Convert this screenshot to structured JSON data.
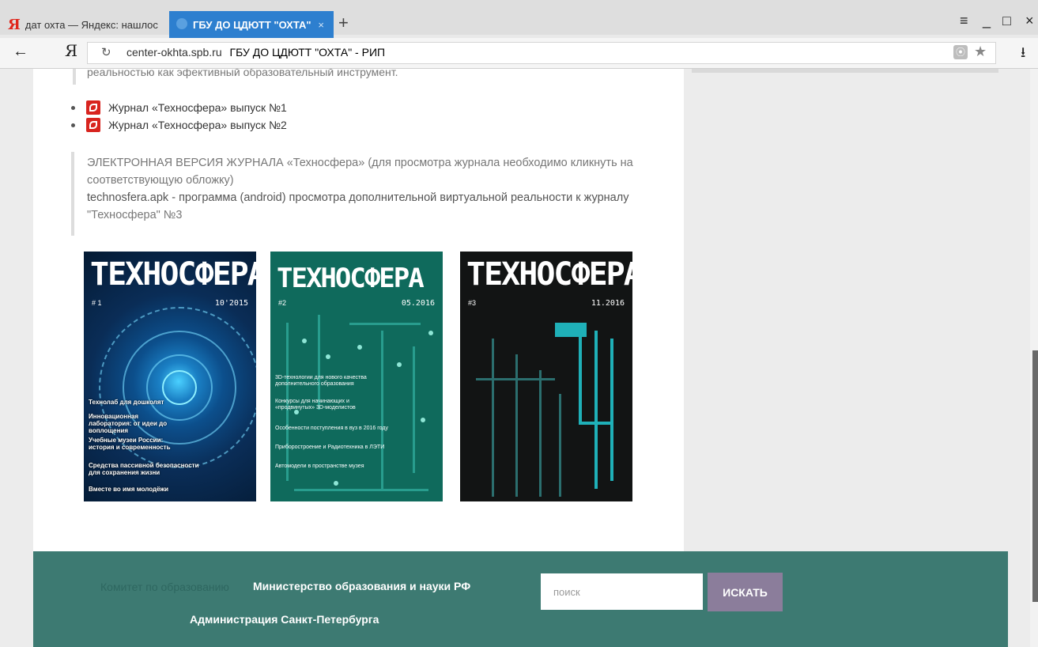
{
  "browser": {
    "tabs": [
      {
        "label": "дат охта — Яндекс: нашлос"
      },
      {
        "label": "ГБУ ДО ЦДЮТТ \"ОХТА\""
      }
    ],
    "new_tab": "+",
    "tab_close": "×",
    "window_controls": {
      "menu": "≡",
      "minimize": "_",
      "maximize": "□",
      "close": "×"
    },
    "yandex_logo": "Я",
    "address": {
      "domain": "center-okhta.spb.ru",
      "title": "ГБУ ДО ЦДЮТТ \"ОХТА\" - РИП"
    },
    "back": "←",
    "reload": "↻",
    "bookmark": "★",
    "download": "⭳"
  },
  "content": {
    "top_quote_text": "реальностью как эфективный образовательный инструмент.",
    "files": [
      {
        "label": "Журнал «Техносфера» выпуск №1"
      },
      {
        "label": "Журнал «Техносфера» выпуск №2"
      }
    ],
    "quote": {
      "line1": "ЭЛЕКТРОННАЯ ВЕРСИЯ ЖУРНАЛА «Техносфера» (для просмотра журнала необходимо кликнуть на",
      "line2": "соответствующую обложку)",
      "line3": "technosfera.apk - программа (android) просмотра дополнительной виртуальной реальности к журналу",
      "line4": "\"Техносфера\" №3"
    },
    "covers": [
      {
        "title": "ТЕХНОСФЕРА",
        "number": "# 1",
        "date": "10'2015",
        "articles": [
          "Технолаб для дошколят",
          "Инновационная лаборатория: от идеи до воплощения",
          "Учебные музеи России: история и современность",
          "Средства пассивной безопасности для сохранения жизни",
          "Вместе во имя молодёжи"
        ]
      },
      {
        "title": "ТЕХНОСФЕРА",
        "number": "#2",
        "date": "05.2016",
        "articles": [
          "3D-технологии для нового качества дополнительного образования",
          "Конкурсы для начинающих и «продвинутых» 3D-моделистов",
          "Особенности поступления в вуз в 2016 году",
          "Приборостроение и Радиотехника в ЛЭТИ",
          "Автомодели в пространстве музея"
        ]
      },
      {
        "title": "ТЕХНОСФЕРА",
        "number": "#3",
        "date": "11.2016",
        "articles": []
      }
    ]
  },
  "footer": {
    "link1": "Комитет по образованию",
    "link2": "Министерство образования и науки РФ",
    "link3": "Администрация Санкт-Петербурга",
    "search_placeholder": "поиск",
    "search_button": "ИСКАТЬ"
  }
}
